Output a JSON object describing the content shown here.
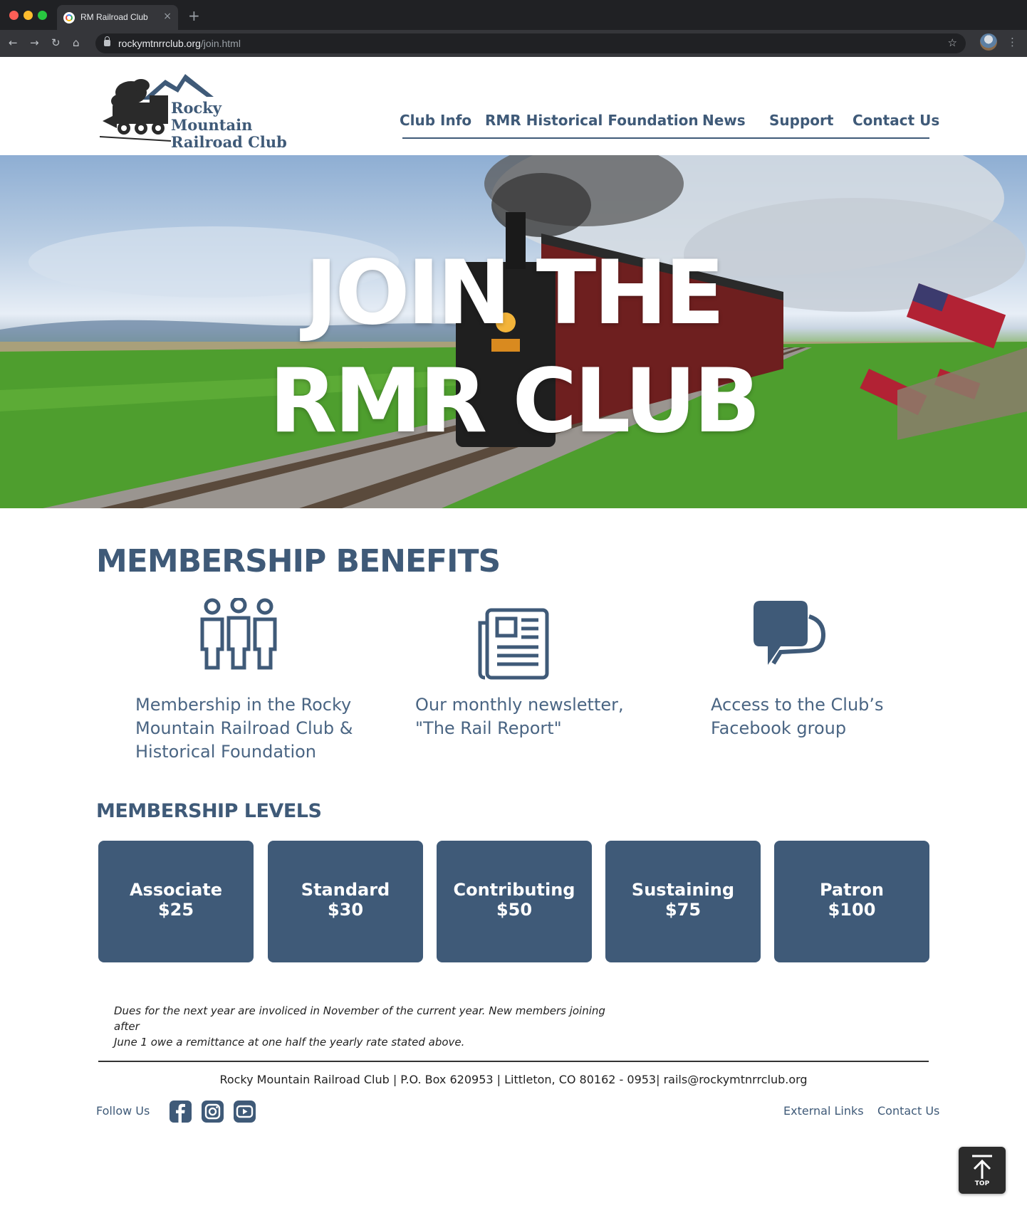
{
  "browser": {
    "tab_title": "RM Railroad Club",
    "url_host": "rockymtnrrclub.org",
    "url_path": "/join.html"
  },
  "header": {
    "logo_line1": "Rocky Mountain",
    "logo_line2": "Railroad Club",
    "nav": [
      {
        "label": "Club Info"
      },
      {
        "label": "RMR Historical Foundation"
      },
      {
        "label": "News"
      },
      {
        "label": "Support"
      },
      {
        "label": "Contact Us"
      }
    ]
  },
  "hero": {
    "line1": "JOIN THE",
    "line2": "RMR CLUB"
  },
  "benefits": {
    "title": "MEMBERSHIP BENEFITS",
    "items": [
      {
        "icon": "people-icon",
        "line1": "Membership in the Rocky",
        "line2": "Mountain Railroad Club &",
        "line3": "Historical Foundation"
      },
      {
        "icon": "newspaper-icon",
        "line1": "Our monthly newsletter,",
        "line2": "\"The Rail Report\""
      },
      {
        "icon": "chat-bubble-icon",
        "line1": "Access to the Club’s",
        "line2": "Facebook group"
      }
    ]
  },
  "levels": {
    "title": "MEMBERSHIP LEVELS",
    "cards": [
      {
        "name": "Associate",
        "price": "$25"
      },
      {
        "name": "Standard",
        "price": "$30"
      },
      {
        "name": "Contributing",
        "price": "$50"
      },
      {
        "name": "Sustaining",
        "price": "$75"
      },
      {
        "name": "Patron",
        "price": "$100"
      }
    ]
  },
  "dues_note": {
    "line1": "Dues for the next year are involiced in November of the current year. New members joining after",
    "line2": "June 1 owe a remittance at one half the yearly rate stated above."
  },
  "footer": {
    "address": "Rocky Mountain Railroad Club | P.O. Box 620953  | Littleton, CO 80162 - 0953| rails@rockymtnrrclub.org",
    "follow_us": "Follow Us",
    "social": [
      "facebook-icon",
      "instagram-icon",
      "youtube-icon"
    ],
    "links": [
      {
        "label": "External Links"
      },
      {
        "label": "Contact Us"
      }
    ],
    "top_label": "TOP"
  },
  "colors": {
    "brand": "#3f5a78",
    "chrome": "#202124",
    "top_button": "#2b2b2b"
  }
}
